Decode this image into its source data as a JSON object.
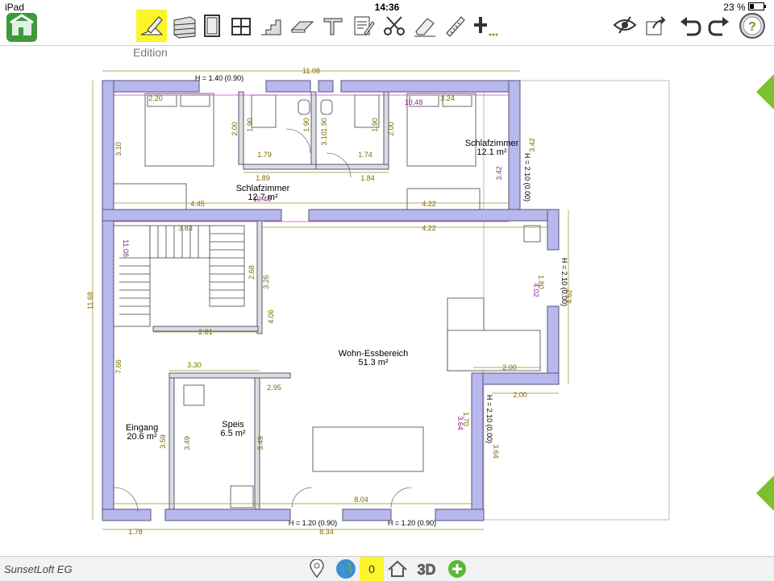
{
  "status": {
    "device": "iPad",
    "time": "14:36",
    "battery": "23 %"
  },
  "toolbar": {
    "mode_label": "Edition",
    "tools": [
      {
        "name": "edit-pencil-icon",
        "selected": true
      },
      {
        "name": "wall-icon"
      },
      {
        "name": "door-icon"
      },
      {
        "name": "window-icon"
      },
      {
        "name": "stairs-icon"
      },
      {
        "name": "floor-icon"
      },
      {
        "name": "beam-icon"
      },
      {
        "name": "note-icon"
      },
      {
        "name": "cut-icon"
      },
      {
        "name": "eraser-icon"
      },
      {
        "name": "measure-icon"
      },
      {
        "name": "add-more-icon"
      }
    ]
  },
  "plan": {
    "rooms": [
      {
        "name": "Schlafzimmer",
        "area": "12.7 m²"
      },
      {
        "name": "Schlafzimmer",
        "area": "12.1 m²"
      },
      {
        "name": "Wohn-Essbereich",
        "area": "51.3 m²"
      },
      {
        "name": "Eingang",
        "area": "20.6 m²"
      },
      {
        "name": "Speis",
        "area": "6.5 m²"
      }
    ],
    "dims": {
      "total_width": "11.08",
      "total_height": "11.68",
      "d_220": "2.20",
      "d_1048a": "10.48",
      "d_324": "3.24",
      "d_200a": "2.00",
      "d_190a": "1.90",
      "d_190b": "1.90",
      "d_190c": "1.90",
      "d_190d": "1.90",
      "d_200b": "2.00",
      "d_310a": "3.10",
      "d_310b": "3.10",
      "d_179": "1.79",
      "d_174": "1.74",
      "d_189": "1.89",
      "d_184": "1.84",
      "d_342": "3.42",
      "d_342b": "3.42",
      "d_445": "4.45",
      "d_1048b": "10.48",
      "d_422a": "4.22",
      "d_422b": "4.22",
      "d_383": "3.83",
      "d_1108v": "11.08",
      "d_268": "2.68",
      "d_326": "3.26",
      "d_406": "4.06",
      "d_281": "2.81",
      "d_766": "7.66",
      "d_330": "3.30",
      "d_295": "2.95",
      "d_359": "3.59",
      "d_349a": "3.49",
      "d_349b": "3.49",
      "d_180": "1.80",
      "d_402": "4.02",
      "d_462": "4.62",
      "d_200c": "2.00",
      "d_200d": "2.00",
      "d_170": "1.70",
      "d_364a": "3.64",
      "d_364b": "3.64",
      "d_804": "8.04",
      "d_178": "1.78",
      "d_834": "8.34"
    },
    "heights": {
      "top_window": "H = 1.40 (0.90)",
      "right_top": "H = 2.10 (0.00)",
      "right_mid": "H = 2.10 (0.00)",
      "right_low": "H = 2.10 (0.00)",
      "bottom_1": "H = 1.20 (0.90)",
      "bottom_2": "H = 1.20 (0.90)"
    }
  },
  "bottom": {
    "project_name": "SunsetLoft EG",
    "level": "0",
    "buttons": [
      "location-pin-icon",
      "globe-icon",
      "level-indicator",
      "house-icon",
      "3d-view-icon",
      "add-circle-icon"
    ]
  },
  "colors": {
    "wall": "#b8b8ee",
    "wall_stroke": "#555577",
    "highlight": "#fbf52a",
    "nav_arrow": "#7cc02e",
    "dim": "#7a6a00"
  }
}
